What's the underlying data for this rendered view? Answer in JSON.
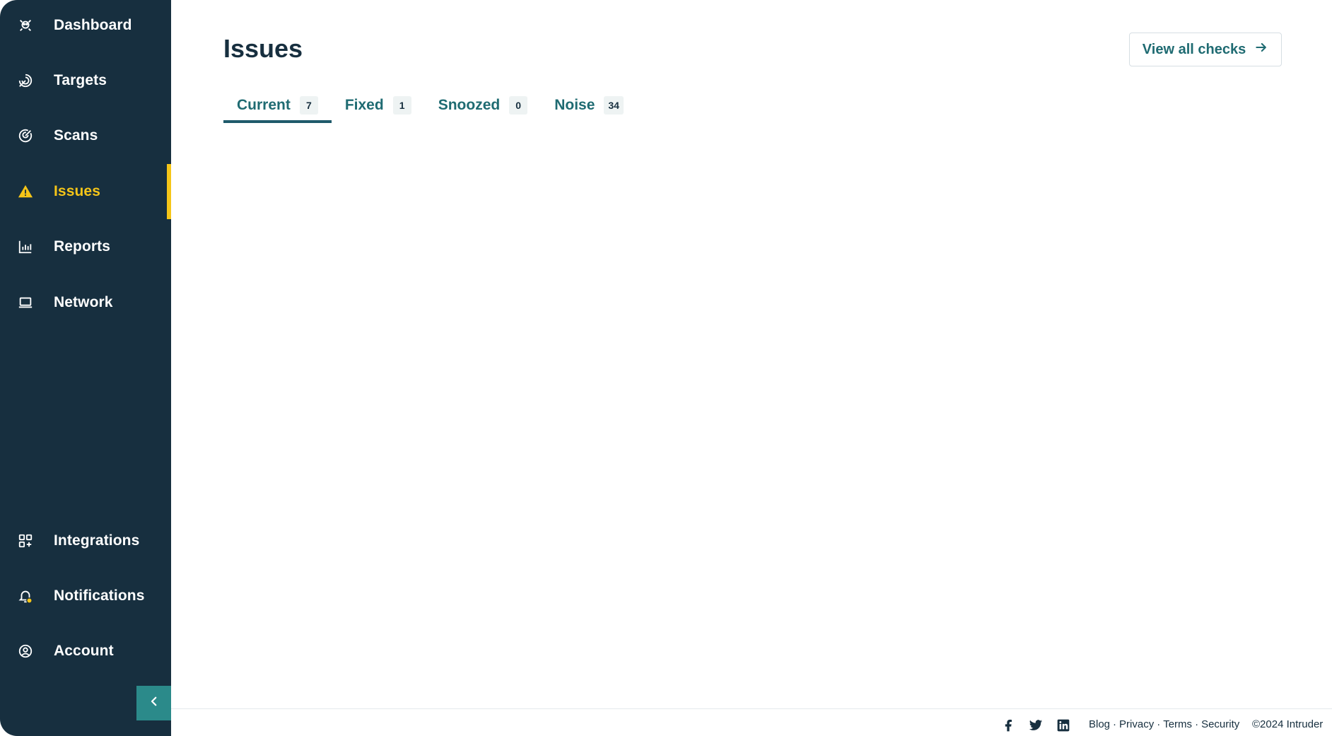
{
  "sidebar": {
    "items": [
      {
        "label": "Dashboard",
        "icon": "dashboard-icon"
      },
      {
        "label": "Targets",
        "icon": "targets-icon"
      },
      {
        "label": "Scans",
        "icon": "scans-icon"
      },
      {
        "label": "Issues",
        "icon": "warning-icon",
        "active": true
      },
      {
        "label": "Reports",
        "icon": "bar-chart-icon"
      },
      {
        "label": "Network",
        "icon": "laptop-icon"
      },
      {
        "label": "Integrations",
        "icon": "integrations-icon"
      },
      {
        "label": "Notifications",
        "icon": "bell-icon"
      },
      {
        "label": "Account",
        "icon": "user-circle-icon"
      }
    ],
    "collapse_icon": "chevron-left-icon"
  },
  "main": {
    "title": "Issues",
    "view_all_label": "View all checks",
    "tabs": [
      {
        "label": "Current",
        "count": "7",
        "active": true
      },
      {
        "label": "Fixed",
        "count": "1"
      },
      {
        "label": "Snoozed",
        "count": "0"
      },
      {
        "label": "Noise",
        "count": "34"
      }
    ]
  },
  "footer": {
    "social": [
      "facebook-icon",
      "twitter-icon",
      "linkedin-icon"
    ],
    "links": [
      "Blog",
      "Privacy",
      "Terms",
      "Security"
    ],
    "separator": "·",
    "copyright": "©2024 Intruder"
  },
  "colors": {
    "sidebar_bg": "#172f3f",
    "accent_yellow": "#f5c518",
    "teal": "#1f6b72",
    "button_teal": "#2b8a8a"
  }
}
